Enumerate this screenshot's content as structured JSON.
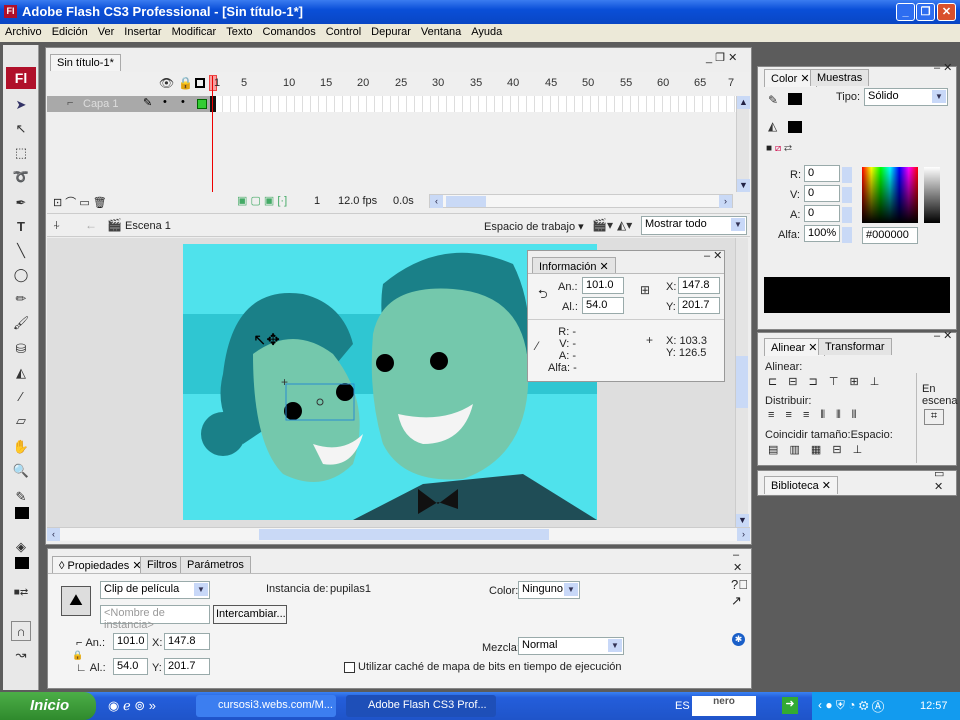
{
  "window": {
    "title": "Adobe Flash CS3 Professional - [Sin título-1*]",
    "app_icon": "Fl"
  },
  "menu": [
    "Archivo",
    "Edición",
    "Ver",
    "Insertar",
    "Modificar",
    "Texto",
    "Comandos",
    "Control",
    "Depurar",
    "Ventana",
    "Ayuda"
  ],
  "document": {
    "tab": "Sin título-1*"
  },
  "timeline": {
    "frame_numbers": [
      "1",
      "5",
      "10",
      "15",
      "20",
      "25",
      "30",
      "35",
      "40",
      "45",
      "50",
      "55",
      "60",
      "65",
      "7"
    ],
    "layer": "Capa 1",
    "current_frame": "1",
    "fps": "12.0 fps",
    "time": "0.0s"
  },
  "editbar": {
    "scene": "Escena 1",
    "workspace": "Espacio de trabajo",
    "zoom": "Mostrar todo"
  },
  "info_panel": {
    "title": "Información",
    "w_label": "An.:",
    "w": "101.0",
    "h_label": "Al.:",
    "h": "54.0",
    "x_label": "X:",
    "x": "147.8",
    "y_label": "Y:",
    "y": "201.7",
    "r": "R: -",
    "v": "V: -",
    "a": "A: -",
    "alfa": "Alfa: -",
    "cursor_x": "X:  103.3",
    "cursor_y": "Y:  126.5"
  },
  "color_panel": {
    "tabs": [
      "Color",
      "Muestras"
    ],
    "type_label": "Tipo:",
    "type": "Sólido",
    "r_label": "R:",
    "r": "0",
    "v_label": "V:",
    "v": "0",
    "a_label": "A:",
    "a": "0",
    "alpha_label": "Alfa:",
    "alpha": "100%",
    "hex": "#000000",
    "color": "#000000"
  },
  "align_panel": {
    "tabs": [
      "Alinear",
      "Transformar"
    ],
    "align": "Alinear:",
    "distribute": "Distribuir:",
    "match": "Coincidir tamaño:",
    "space": "Espacio:",
    "stage": "En escena"
  },
  "library_panel": {
    "tab": "Biblioteca"
  },
  "properties": {
    "tabs": [
      "Propiedades",
      "Filtros",
      "Parámetros"
    ],
    "symbol_type": "Clip de película",
    "instance_of_label": "Instancia de:",
    "instance_of": "pupilas1",
    "instance_name_placeholder": "<Nombre de instancia>",
    "swap_button": "Intercambiar...",
    "color_label": "Color:",
    "color": "Ninguno",
    "w_label": "An.:",
    "w": "101.0",
    "x_label": "X:",
    "x": "147.8",
    "h_label": "Al.:",
    "h": "54.0",
    "y_label": "Y:",
    "y": "201.7",
    "blend_label": "Mezcla:",
    "blend": "Normal",
    "cache_label": "Utilizar caché de mapa de bits en tiempo de ejecución",
    "cache_checked": false
  },
  "taskbar": {
    "start": "Inicio",
    "tasks": [
      "cursosi3.webs.com/M...",
      "Adobe Flash CS3 Prof..."
    ],
    "lang": "ES",
    "nero": "nero",
    "time": "12:57"
  }
}
